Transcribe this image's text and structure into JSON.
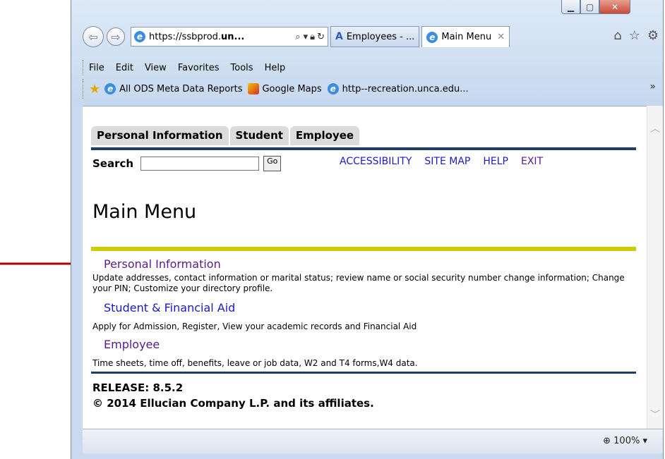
{
  "window": {
    "url_prefix": "https://ssbprod.",
    "url_bold": "un...",
    "tabs": [
      {
        "label": "Employees - ...",
        "icon": "acrobat-icon"
      },
      {
        "label": "Main Menu",
        "icon": "ie-icon"
      }
    ],
    "menubar": [
      "File",
      "Edit",
      "View",
      "Favorites",
      "Tools",
      "Help"
    ],
    "favorites": [
      "All ODS Meta Data Reports",
      "Google Maps",
      "http--recreation.unca.edu..."
    ],
    "zoom": "100%"
  },
  "page": {
    "tabs": [
      "Personal Information",
      "Student",
      "Employee"
    ],
    "search_label": "Search",
    "go_label": "Go",
    "top_links": [
      "ACCESSIBILITY",
      "SITE MAP",
      "HELP",
      "EXIT"
    ],
    "title": "Main Menu",
    "menu": [
      {
        "link": "Personal Information",
        "desc": "Update addresses, contact information or marital status; review name or social security number change information; Change your PIN; Customize your directory profile."
      },
      {
        "link": "Student & Financial Aid",
        "desc": "Apply for Admission, Register, View your academic records and Financial Aid"
      },
      {
        "link": "Employee",
        "desc": "Time sheets, time off, benefits, leave or job data, W2 and T4 forms,W4 data."
      }
    ],
    "release": "RELEASE: 8.5.2",
    "copyright": "© 2014 Ellucian Company L.P. and its affiliates."
  },
  "colors": {
    "link": "#1a1ac8",
    "visited": "#5a1a8a",
    "navy_bar": "#1d3d6d",
    "yellow_bar": "#cccc00",
    "arrow": "#b00000"
  }
}
